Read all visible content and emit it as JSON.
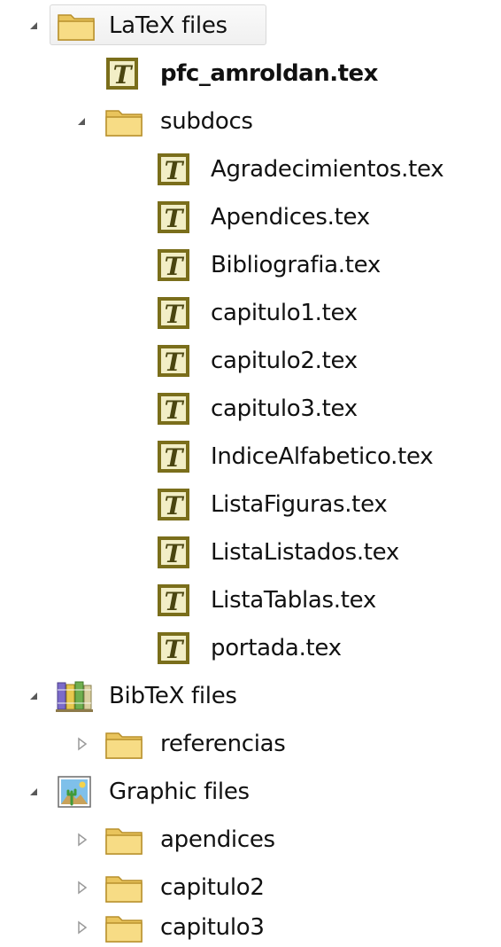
{
  "colors": {
    "folder_fill": "#f4d77a",
    "folder_edge": "#c9a23b",
    "tex_icon_border": "#7a6e1b",
    "tex_icon_fill": "#f2eec6",
    "tex_letter": "#4a4510",
    "expanded_arrow": "#5a5a5a",
    "collapsed_arrow": "#9a9a9a"
  },
  "tree": {
    "latex": {
      "label": "LaTeX files",
      "expanded": true,
      "icon": "folder-icon",
      "root_file": {
        "label": "pfc_amroldan.tex",
        "icon": "tex-file-icon"
      },
      "subdocs": {
        "label": "subdocs",
        "expanded": true,
        "icon": "folder-icon",
        "files": [
          {
            "label": "Agradecimientos.tex",
            "icon": "tex-file-icon"
          },
          {
            "label": "Apendices.tex",
            "icon": "tex-file-icon"
          },
          {
            "label": "Bibliografia.tex",
            "icon": "tex-file-icon"
          },
          {
            "label": "capitulo1.tex",
            "icon": "tex-file-icon"
          },
          {
            "label": "capitulo2.tex",
            "icon": "tex-file-icon"
          },
          {
            "label": "capitulo3.tex",
            "icon": "tex-file-icon"
          },
          {
            "label": "IndiceAlfabetico.tex",
            "icon": "tex-file-icon"
          },
          {
            "label": "ListaFiguras.tex",
            "icon": "tex-file-icon"
          },
          {
            "label": "ListaListados.tex",
            "icon": "tex-file-icon"
          },
          {
            "label": "ListaTablas.tex",
            "icon": "tex-file-icon"
          },
          {
            "label": "portada.tex",
            "icon": "tex-file-icon"
          }
        ]
      }
    },
    "bibtex": {
      "label": "BibTeX files",
      "expanded": true,
      "icon": "books-icon",
      "children": [
        {
          "label": "referencias",
          "icon": "folder-icon",
          "expanded": false
        }
      ]
    },
    "graphic": {
      "label": "Graphic files",
      "expanded": true,
      "icon": "image-icon",
      "children": [
        {
          "label": "apendices",
          "icon": "folder-icon",
          "expanded": false
        },
        {
          "label": "capitulo2",
          "icon": "folder-icon",
          "expanded": false
        },
        {
          "label": "capitulo3",
          "icon": "folder-icon",
          "expanded": false
        }
      ]
    }
  }
}
